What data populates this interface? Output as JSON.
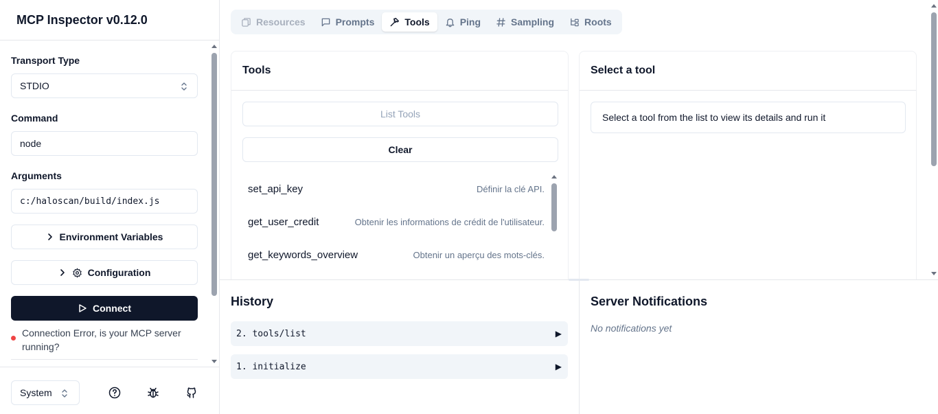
{
  "app": {
    "title": "MCP Inspector v0.12.0"
  },
  "sidebar": {
    "transport": {
      "label": "Transport Type",
      "value": "STDIO"
    },
    "command": {
      "label": "Command",
      "value": "node"
    },
    "arguments": {
      "label": "Arguments",
      "value": "c:/haloscan/build/index.js"
    },
    "env_button": "Environment Variables",
    "config_button": "Configuration",
    "connect_button": "Connect",
    "status": {
      "text": "Connection Error, is your MCP server running?",
      "color": "#ef4444"
    },
    "footer": {
      "theme": "System"
    }
  },
  "tabs": [
    {
      "label": "Resources",
      "icon": "file-icon",
      "state": "disabled"
    },
    {
      "label": "Prompts",
      "icon": "message-icon",
      "state": "normal"
    },
    {
      "label": "Tools",
      "icon": "hammer-icon",
      "state": "active"
    },
    {
      "label": "Ping",
      "icon": "bell-icon",
      "state": "normal"
    },
    {
      "label": "Sampling",
      "icon": "hash-icon",
      "state": "normal"
    },
    {
      "label": "Roots",
      "icon": "folder-tree-icon",
      "state": "normal"
    }
  ],
  "tools_panel": {
    "title": "Tools",
    "list_button": "List Tools",
    "clear_button": "Clear",
    "items": [
      {
        "name": "set_api_key",
        "description": "Définir la clé API."
      },
      {
        "name": "get_user_credit",
        "description": "Obtenir les informations de crédit de l'utilisateur."
      },
      {
        "name": "get_keywords_overview",
        "description": "Obtenir un aperçu des mots-clés."
      }
    ]
  },
  "detail_panel": {
    "title": "Select a tool",
    "message": "Select a tool from the list to view its details and run it"
  },
  "history": {
    "title": "History",
    "items": [
      {
        "text": "2. tools/list",
        "arrow": "▶"
      },
      {
        "text": "1. initialize",
        "arrow": "▶"
      }
    ]
  },
  "notifications": {
    "title": "Server Notifications",
    "empty": "No notifications yet"
  }
}
